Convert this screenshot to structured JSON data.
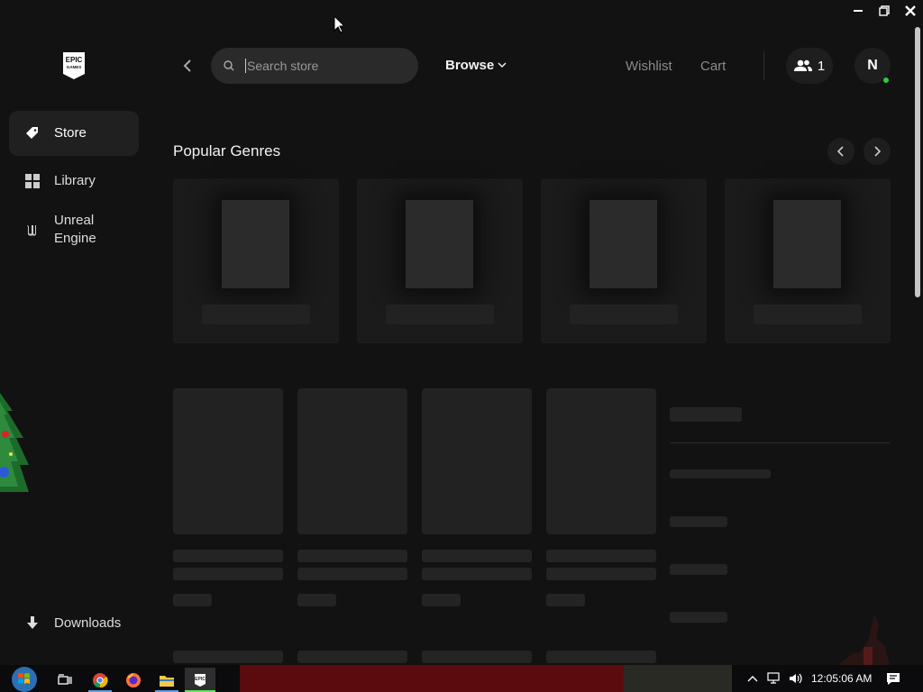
{
  "window": {
    "controls": [
      "minimize",
      "restore",
      "close"
    ]
  },
  "sidebar": {
    "logo_text": "EPIC GAMES",
    "items": [
      {
        "label": "Store",
        "icon": "tag-icon",
        "active": true
      },
      {
        "label": "Library",
        "icon": "grid-icon",
        "active": false
      },
      {
        "label": "Unreal Engine",
        "icon": "unreal-icon",
        "active": false
      }
    ],
    "downloads_label": "Downloads"
  },
  "header": {
    "search_placeholder": "Search store",
    "browse_label": "Browse",
    "wishlist_label": "Wishlist",
    "cart_label": "Cart",
    "friends_count": "1",
    "avatar_initial": "N",
    "online_color": "#2ecc40"
  },
  "main": {
    "section_title": "Popular Genres",
    "genre_placeholders": 4,
    "game_placeholders": 4
  },
  "taskbar": {
    "clock": "12:05:06 AM",
    "apps": [
      "task-view-icon",
      "chrome-icon",
      "firefox-icon",
      "file-explorer-icon",
      "epic-games-icon"
    ],
    "accent": "#5aa0e6"
  }
}
